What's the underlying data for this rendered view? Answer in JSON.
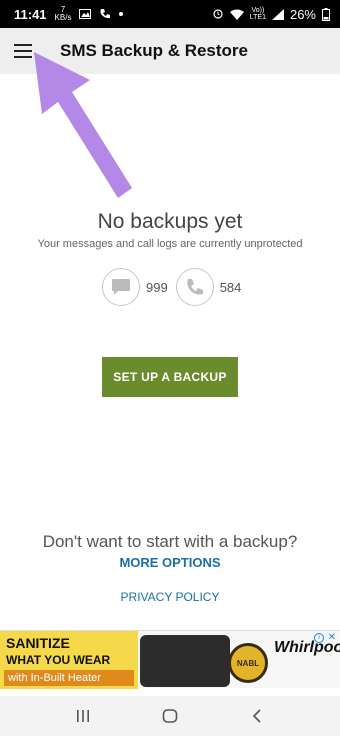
{
  "status_bar": {
    "time": "11:41",
    "small_top": "7",
    "small_bottom": "KB/s",
    "network_top": "Vo))",
    "network_bottom": "LTE1",
    "battery": "26%"
  },
  "toolbar": {
    "title": "SMS Backup & Restore"
  },
  "empty_state": {
    "title": "No backups yet",
    "subtitle": "Your messages and call logs are currently unprotected",
    "message_count": "999",
    "call_count": "584",
    "setup_button": "SET UP A BACKUP"
  },
  "options": {
    "question": "Don't want to start with a backup?",
    "more_options": "MORE OPTIONS",
    "privacy_policy": "PRIVACY POLICY"
  },
  "ad": {
    "line1": "SANITIZE",
    "line2": "WHAT YOU WEAR",
    "line3": "with In-Built Heater",
    "badge": "NABL",
    "brand": "Whirlpool",
    "info": "i",
    "close": "✕"
  },
  "colors": {
    "accent_green": "#6b8c2c",
    "link_blue": "#1b6fa6",
    "arrow_purple": "#b388e6"
  },
  "icons": {
    "menu": "hamburger-icon",
    "messages": "chat-bubble-icon",
    "calls": "phone-icon",
    "nav_recents": "recents-icon",
    "nav_home": "home-icon",
    "nav_back": "back-icon"
  }
}
